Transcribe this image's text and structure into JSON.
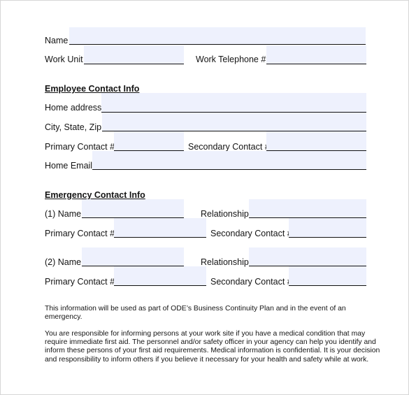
{
  "form": {
    "name_label": "Name",
    "name_value": "",
    "work_unit_label": "Work Unit",
    "work_unit_value": "",
    "work_telephone_label": "Work Telephone #",
    "work_telephone_value": ""
  },
  "employee_contact": {
    "heading": "Employee Contact Info",
    "home_address_label": "Home address",
    "home_address_value": "",
    "city_state_zip_label": "City, State, Zip",
    "city_state_zip_value": "",
    "primary_contact_label": "Primary Contact #",
    "primary_contact_value": "",
    "secondary_contact_label": "Secondary Contact #",
    "secondary_contact_value": "",
    "home_email_label": "Home Email",
    "home_email_value": ""
  },
  "emergency_contact": {
    "heading": "Emergency Contact Info",
    "contacts": [
      {
        "name_label": "(1) Name",
        "name_value": "",
        "relationship_label": "Relationship",
        "relationship_value": "",
        "primary_contact_label": "Primary Contact #",
        "primary_contact_value": "",
        "secondary_contact_label": "Secondary Contact #",
        "secondary_contact_value": ""
      },
      {
        "name_label": "(2) Name",
        "name_value": "",
        "relationship_label": "Relationship",
        "relationship_value": "",
        "primary_contact_label": "Primary Contact #",
        "primary_contact_value": "",
        "secondary_contact_label": "Secondary Contact #",
        "secondary_contact_value": ""
      }
    ]
  },
  "notes": {
    "paragraph1": "This information will be used as part of ODE's Business Continuity Plan and in the event of an emergency.",
    "paragraph2_lines": [
      "You are responsible for informing persons at your work site if you have a medical condition that may",
      "require immediate first aid.  The personnel and/or safety officer in your agency can help you identify and",
      "inform these persons of your first aid requirements.  Medical information is confidential.  It is your decision",
      "and responsibility to inform others if you believe it necessary for your health and safety while at work."
    ],
    "paragraph1_lines": [
      "This information will be used as part of ODE’s Business Continuity Plan and in the event of an",
      "emergency."
    ]
  },
  "colors": {
    "field_fill": "#eef1fd",
    "underline": "#111111",
    "page_border": "#d6d6d6"
  }
}
